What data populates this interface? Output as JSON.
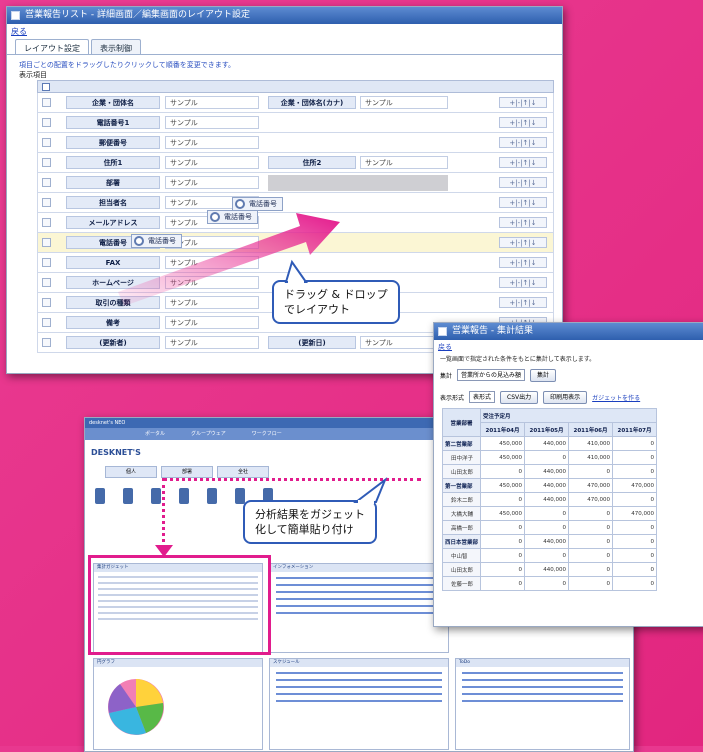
{
  "main_window": {
    "title": "営業報告リスト - 詳細画面／編集画面のレイアウト設定",
    "back_link": "戻る",
    "tabs": [
      "レイアウト設定",
      "表示制御"
    ],
    "instruction": "項目ごとの配置をドラッグしたりクリックして順番を変更できます。",
    "section_label": "表示項目",
    "sample": "サンプル",
    "row_control": "+|-|↑|↓",
    "rows": [
      {
        "left": "企業・団体名",
        "right": "企業・団体名(カナ)"
      },
      {
        "left": "電話番号1",
        "right": ""
      },
      {
        "left": "郵便番号",
        "right": ""
      },
      {
        "left": "住所1",
        "right": "住所2"
      },
      {
        "left": "部署",
        "right": ""
      },
      {
        "left": "担当者名",
        "right": ""
      },
      {
        "left": "メールアドレス",
        "right": ""
      },
      {
        "left": "電話番号",
        "right": ""
      },
      {
        "left": "FAX",
        "right": ""
      },
      {
        "left": "ホームページ",
        "right": ""
      },
      {
        "left": "取引の種類",
        "right": ""
      },
      {
        "left": "備考",
        "right": ""
      },
      {
        "left": "(更新者)",
        "right": "(更新日)"
      }
    ],
    "drag_chips": [
      "電話番号",
      "電話番号",
      "電話番号"
    ]
  },
  "callout_drag": {
    "line1": "ドラッグ & ドロップ",
    "line2": "でレイアウト"
  },
  "callout_gadget": {
    "line1": "分析結果をガジェット",
    "line2": "化して簡単貼り付け"
  },
  "report_window": {
    "title": "営業報告 - 集計結果",
    "back_link": "戻る",
    "description": "一覧画面で指定された条件をもとに集計して表示します。",
    "filter_label": "集計",
    "filter_value": "営業所からの見込み額",
    "filter_button": "集計",
    "view_label": "表示形式",
    "view_value": "表形式",
    "buttons": [
      "CSV出力",
      "印刷用表示"
    ],
    "gadget_link": "ガジェットを作る",
    "col_header_top": "受注予定月",
    "row_header": "営業部署",
    "columns": [
      "2011年04月",
      "2011年05月",
      "2011年06月",
      "2011年07月"
    ],
    "rows": [
      {
        "name": "第二営業部",
        "sub": false,
        "values": [
          "450,000",
          "440,000",
          "410,000",
          "0"
        ]
      },
      {
        "name": "田中洋子",
        "sub": true,
        "values": [
          "450,000",
          "0",
          "410,000",
          "0"
        ]
      },
      {
        "name": "山田太郎",
        "sub": true,
        "values": [
          "0",
          "440,000",
          "0",
          "0"
        ]
      },
      {
        "name": "第一営業部",
        "sub": false,
        "values": [
          "450,000",
          "440,000",
          "470,000",
          "470,000"
        ]
      },
      {
        "name": "鈴木二郎",
        "sub": true,
        "values": [
          "0",
          "440,000",
          "470,000",
          "0"
        ]
      },
      {
        "name": "大橋大輔",
        "sub": true,
        "values": [
          "450,000",
          "0",
          "0",
          "470,000"
        ]
      },
      {
        "name": "高橋一郎",
        "sub": true,
        "values": [
          "0",
          "0",
          "0",
          "0"
        ]
      },
      {
        "name": "西日本営業部",
        "sub": false,
        "values": [
          "0",
          "440,000",
          "0",
          "0"
        ]
      },
      {
        "name": "中山智",
        "sub": true,
        "values": [
          "0",
          "0",
          "0",
          "0"
        ]
      },
      {
        "name": "山田太郎",
        "sub": true,
        "values": [
          "0",
          "440,000",
          "0",
          "0"
        ]
      },
      {
        "name": "佐藤一郎",
        "sub": true,
        "values": [
          "0",
          "0",
          "0",
          "0"
        ]
      }
    ]
  },
  "dashboard": {
    "top_bar": "desknet's NEO",
    "nav": [
      "ポータル",
      "グループウェア",
      "ワークフロー"
    ],
    "logo": "DESKNET'S",
    "tabs": [
      "個人",
      "部署",
      "全社"
    ],
    "gadget_titles": [
      "集計ガジェット",
      "インフォメーション",
      "スケジュール",
      "円グラフ",
      "ToDo"
    ]
  },
  "colors": {
    "background": "#e8388f",
    "accent_pink": "#e11c8d",
    "window_title": "#2e5fae",
    "callout_border": "#2f5bb7"
  }
}
